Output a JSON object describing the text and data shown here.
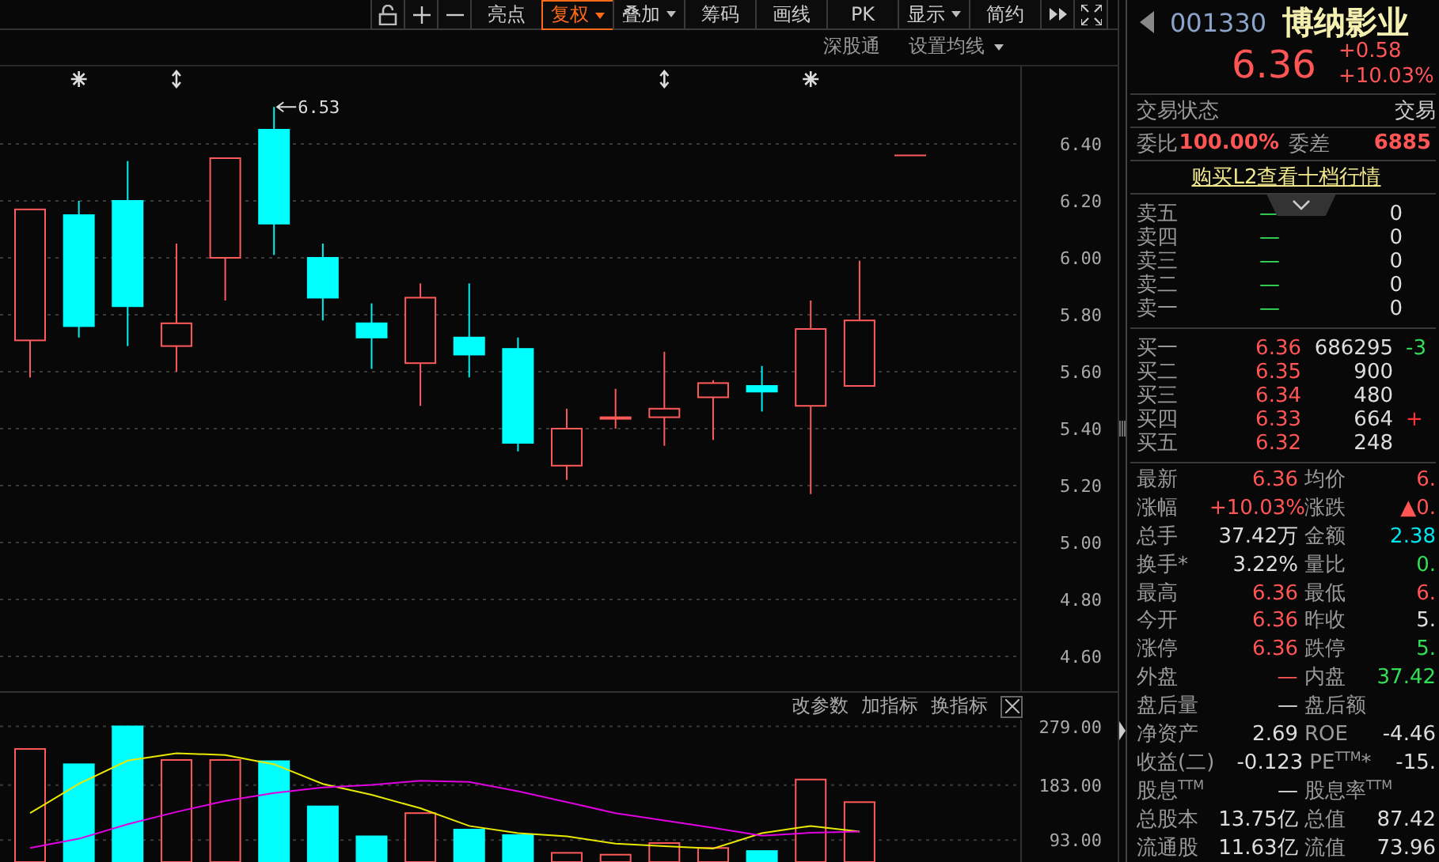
{
  "toolbar": [
    {
      "kind": "lock"
    },
    {
      "kind": "plus"
    },
    {
      "kind": "minus"
    },
    {
      "kind": "text",
      "label": "亮点",
      "selected": false,
      "dropdown": false
    },
    {
      "kind": "text",
      "label": "复权",
      "selected": true,
      "dropdown": true
    },
    {
      "kind": "text",
      "label": "叠加",
      "selected": false,
      "dropdown": true
    },
    {
      "kind": "text",
      "label": "筹码",
      "selected": false,
      "dropdown": false
    },
    {
      "kind": "text",
      "label": "画线",
      "selected": false,
      "dropdown": false
    },
    {
      "kind": "text",
      "label": "PK",
      "selected": false,
      "dropdown": false
    },
    {
      "kind": "text",
      "label": "显示",
      "selected": false,
      "dropdown": true
    },
    {
      "kind": "text",
      "label": "简约",
      "selected": false,
      "dropdown": false
    },
    {
      "kind": "forward"
    },
    {
      "kind": "fullscreen"
    }
  ],
  "chart_header": {
    "links": [
      {
        "label": "深股通",
        "dropdown": false
      },
      {
        "label": "设置均线",
        "dropdown": true
      }
    ]
  },
  "price_chart": {
    "high_label": "6.53",
    "axis_labels": [
      "6.40",
      "6.20",
      "6.00",
      "5.80",
      "5.60",
      "5.40",
      "5.20",
      "5.00",
      "4.80",
      "4.60"
    ]
  },
  "volume_panel": {
    "actions": [
      "改参数",
      "加指标",
      "换指标"
    ],
    "closable": true,
    "chart_data": {
      "type": "bar",
      "grid": true,
      "ylim": [
        57,
        290
      ],
      "yticks": [
        {
          "value": 279,
          "label": "279.00"
        },
        {
          "value": 183,
          "label": "183.00"
        },
        {
          "value": 93,
          "label": "93.00"
        }
      ],
      "series": [
        {
          "values": [
            242,
            217,
            279,
            224,
            224,
            222,
            148,
            99,
            137,
            110,
            101,
            72,
            69,
            88,
            80,
            75,
            192,
            155
          ],
          "colors": [
            "#ff5a5a",
            "#00ffff",
            "#00ffff",
            "#ff5a5a",
            "#ff5a5a",
            "#00ffff",
            "#00ffff",
            "#00ffff",
            "#ff5a5a",
            "#00ffff",
            "#00ffff",
            "#ff5a5a",
            "#ff5a5a",
            "#ff5a5a",
            "#ff5a5a",
            "#00ffff",
            "#ff5a5a",
            "#ff5a5a"
          ]
        },
        {
          "type": "line",
          "color": "#e8e800",
          "values": [
            137,
            185,
            223,
            235,
            232,
            217,
            185,
            167,
            145,
            116,
            104,
            99,
            87,
            83,
            79,
            104,
            116,
            107
          ]
        },
        {
          "type": "line",
          "color": "#e000e0",
          "values": [
            80,
            95,
            119,
            139,
            157,
            170,
            179,
            183,
            190,
            188,
            173,
            155,
            137,
            125,
            113,
            100,
            105,
            107
          ]
        }
      ]
    }
  },
  "quote": {
    "code": "001330",
    "name": "博纳影业",
    "price": "6.36",
    "change": "+0.58",
    "change_pct": "+10.03%"
  },
  "status_row": {
    "label": "交易状态",
    "value": "交易"
  },
  "ratio_row": [
    {
      "label": "委比",
      "value": "100.00%",
      "color": "#ff5555"
    },
    {
      "label": "委差",
      "value": "6885",
      "color": "#ff5555"
    }
  ],
  "l2_link": "购买L2查看十档行情",
  "asks": [
    {
      "label": "卖五",
      "price": "—",
      "volume": "0"
    },
    {
      "label": "卖四",
      "price": "—",
      "volume": "0"
    },
    {
      "label": "卖三",
      "price": "—",
      "volume": "0"
    },
    {
      "label": "卖二",
      "price": "—",
      "volume": "0"
    },
    {
      "label": "卖一",
      "price": "—",
      "volume": "0"
    }
  ],
  "bids": [
    {
      "label": "买一",
      "price": "6.36",
      "volume": "686295",
      "change": {
        "text": "-3",
        "color": "#33dd55"
      }
    },
    {
      "label": "买二",
      "price": "6.35",
      "volume": "900"
    },
    {
      "label": "买三",
      "price": "6.34",
      "volume": "480"
    },
    {
      "label": "买四",
      "price": "6.33",
      "volume": "664",
      "change": {
        "text": "+",
        "color": "#ff3333"
      }
    },
    {
      "label": "买五",
      "price": "6.32",
      "volume": "248"
    }
  ],
  "stats": [
    [
      {
        "label": "最新",
        "value": "6.36",
        "color": "#ff5555"
      },
      {
        "label": "均价",
        "value": "6.",
        "color": "#ff5555"
      }
    ],
    [
      {
        "label": "涨幅",
        "value": "+10.03%",
        "color": "#ff5555"
      },
      {
        "label": "涨跌",
        "value": "▲0.",
        "color": "#ff5555"
      }
    ],
    [
      {
        "label": "总手",
        "value": "37.42万",
        "color": "#dddddd"
      },
      {
        "label": "金额",
        "value": "2.38",
        "color": "#00e5ee"
      }
    ],
    [
      {
        "label": "换手*",
        "value": "3.22%",
        "color": "#dddddd"
      },
      {
        "label": "量比",
        "value": "0.",
        "color": "#33dd55"
      }
    ],
    [
      {
        "label": "最高",
        "value": "6.36",
        "color": "#ff5555"
      },
      {
        "label": "最低",
        "value": "6.",
        "color": "#ff5555"
      }
    ],
    [
      {
        "label": "今开",
        "value": "6.36",
        "color": "#ff5555"
      },
      {
        "label": "昨收",
        "value": "5.",
        "color": "#dddddd"
      }
    ],
    [
      {
        "label": "涨停",
        "value": "6.36",
        "color": "#ff5555"
      },
      {
        "label": "跌停",
        "value": "5.",
        "color": "#33dd55"
      }
    ],
    [
      {
        "label": "外盘",
        "value": "—",
        "color": "#ff5555"
      },
      {
        "label": "内盘",
        "value": "37.42",
        "color": "#33dd55"
      }
    ],
    [
      {
        "label": "盘后量",
        "value": "—",
        "color": "#dddddd"
      },
      {
        "label": "盘后额"
      }
    ],
    [
      {
        "label": "净资产",
        "value": "2.69",
        "color": "#dddddd"
      },
      {
        "label": "ROE",
        "value": "-4.46",
        "color": "#dddddd"
      }
    ],
    [
      {
        "label": "收益(二)",
        "value": "-0.123",
        "color": "#dddddd"
      },
      {
        "label": "PE$^{TTM}$*",
        "value": "-15.",
        "color": "#dddddd"
      }
    ],
    [
      {
        "label": "股息$^{TTM}$",
        "value": "—",
        "color": "#dddddd"
      },
      {
        "label": "股息率$^{TTM}$"
      }
    ],
    [
      {
        "label": "总股本",
        "value": "13.75亿",
        "color": "#dddddd"
      },
      {
        "label": "总值",
        "value": "87.42",
        "color": "#dddddd"
      }
    ],
    [
      {
        "label": "流通股",
        "value": "11.63亿",
        "color": "#dddddd"
      },
      {
        "label": "流值",
        "value": "73.96",
        "color": "#dddddd"
      }
    ]
  ]
}
